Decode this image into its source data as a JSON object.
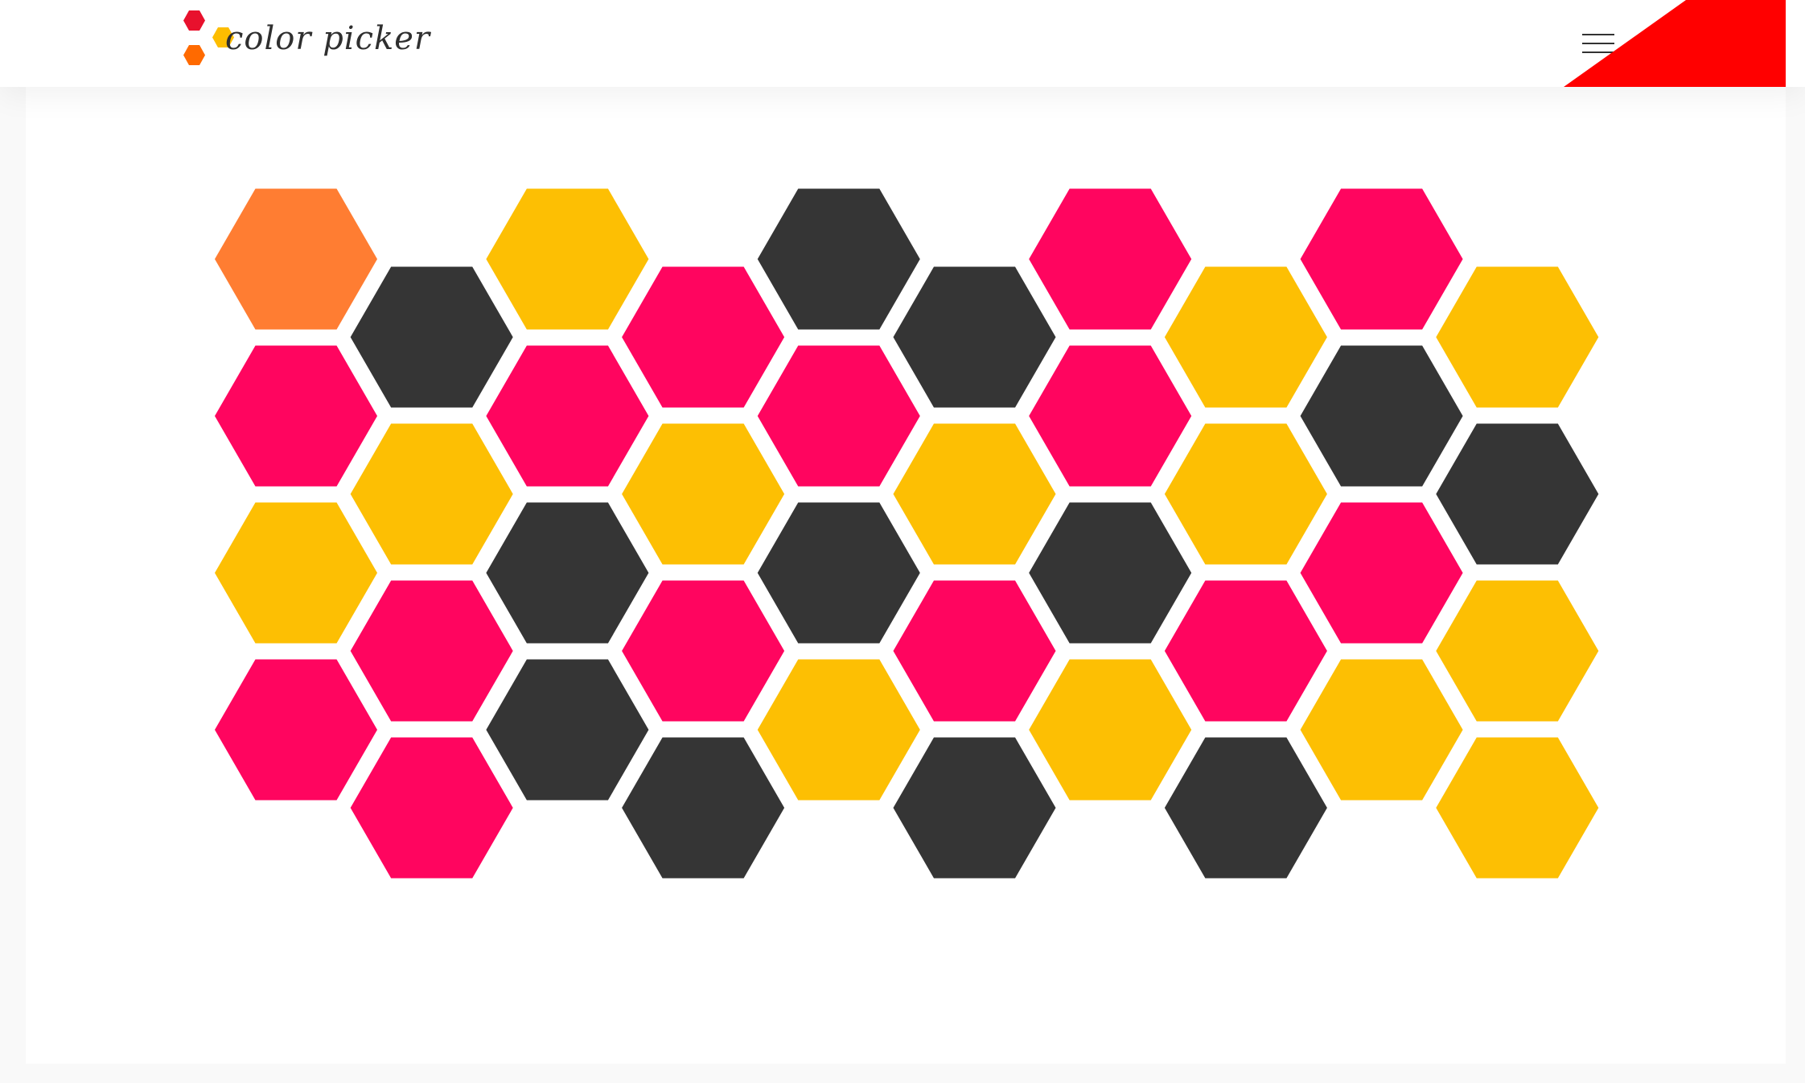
{
  "app": {
    "name": "color picker"
  },
  "header": {
    "menu_icon": "hamburger-menu-icon",
    "corner_color": "#ff0000"
  },
  "logo": {
    "colors": [
      "#e8112d",
      "#ff6a00",
      "#fdbd00"
    ]
  },
  "palette": {
    "orange": "#ff7d32",
    "pink": "#ff055f",
    "dark": "#353535",
    "yellow": "#fdbf03"
  },
  "grid": {
    "columns": [
      [
        "orange",
        "pink",
        "yellow",
        "pink"
      ],
      [
        "dark",
        "yellow",
        "pink",
        "pink"
      ],
      [
        "yellow",
        "pink",
        "dark",
        "dark"
      ],
      [
        "pink",
        "yellow",
        "pink",
        "dark"
      ],
      [
        "dark",
        "pink",
        "dark",
        "yellow"
      ],
      [
        "dark",
        "yellow",
        "pink",
        "dark"
      ],
      [
        "pink",
        "pink",
        "dark",
        "yellow"
      ],
      [
        "yellow",
        "yellow",
        "pink",
        "dark"
      ],
      [
        "pink",
        "dark",
        "pink",
        "yellow"
      ],
      [
        "yellow",
        "dark",
        "yellow",
        "yellow"
      ]
    ]
  }
}
